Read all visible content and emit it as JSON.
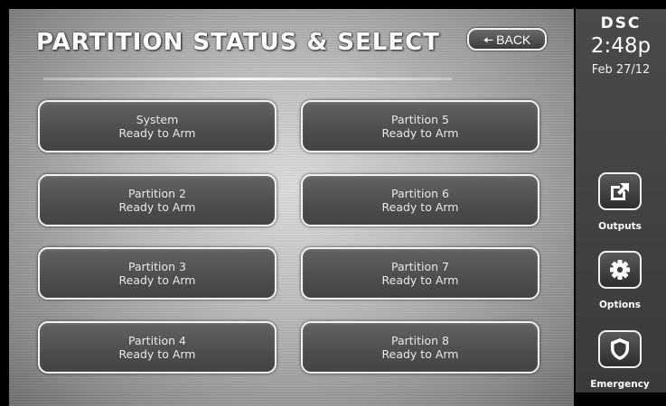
{
  "header": {
    "title": "PARTITION STATUS & SELECT",
    "back_label": "BACK"
  },
  "partitions": [
    {
      "name": "System",
      "status": "Ready to Arm"
    },
    {
      "name": "Partition 2",
      "status": "Ready to Arm"
    },
    {
      "name": "Partition 3",
      "status": "Ready to Arm"
    },
    {
      "name": "Partition 4",
      "status": "Ready to Arm"
    },
    {
      "name": "Partition 5",
      "status": "Ready to Arm"
    },
    {
      "name": "Partition 6",
      "status": "Ready to Arm"
    },
    {
      "name": "Partition 7",
      "status": "Ready to Arm"
    },
    {
      "name": "Partition 8",
      "status": "Ready to Arm"
    }
  ],
  "sidebar": {
    "logo": "DSC",
    "time": "2:48p",
    "date": "Feb 27/12",
    "buttons": [
      {
        "label": "Outputs",
        "icon": "outputs-icon"
      },
      {
        "label": "Options",
        "icon": "gear-icon"
      },
      {
        "label": "Emergency",
        "icon": "shield-icon"
      }
    ]
  }
}
